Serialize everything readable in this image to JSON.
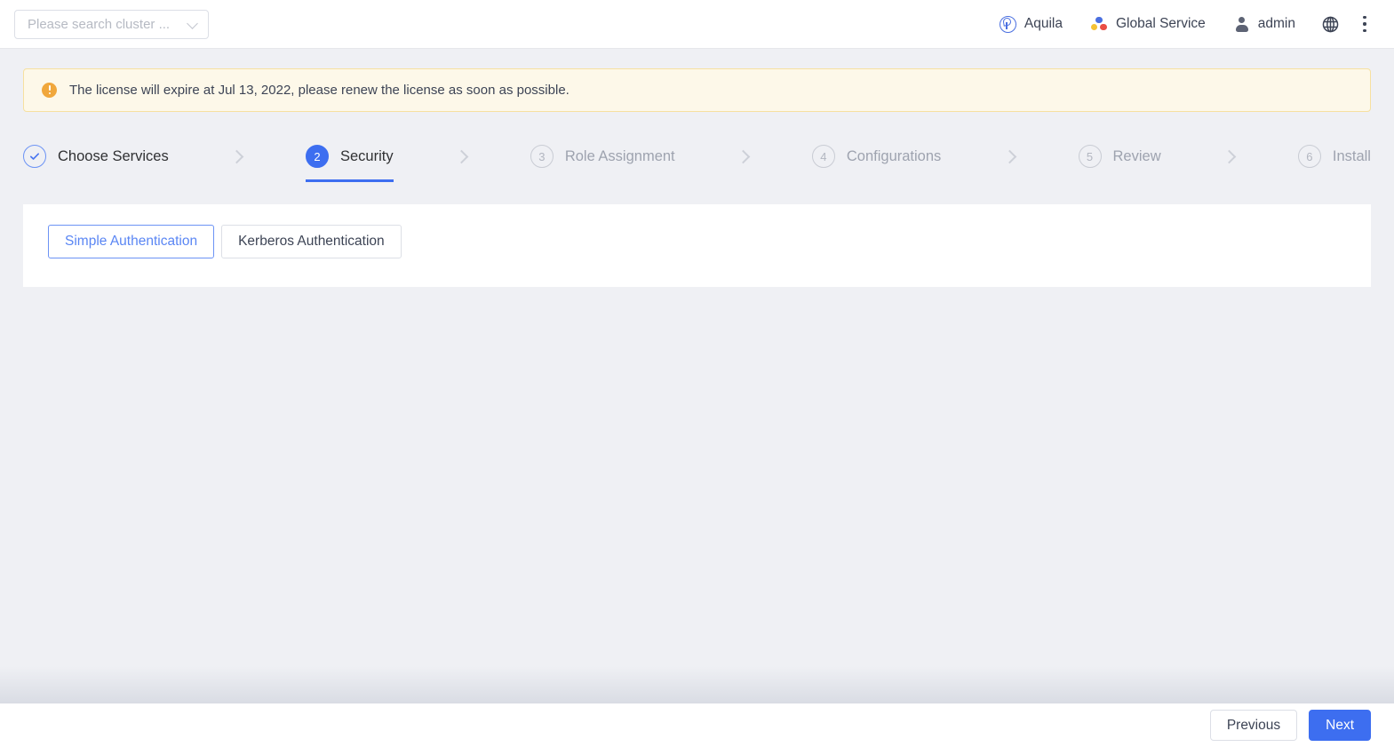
{
  "header": {
    "cluster_search": {
      "placeholder": "Please search cluster ...",
      "value": "",
      "caret_icon": "chevron-down-icon"
    },
    "items": [
      {
        "label": "Aquila",
        "icon": "aquila-logo-icon"
      },
      {
        "label": "Global Service",
        "icon": "global-service-icon"
      },
      {
        "label": "admin",
        "icon": "user-icon"
      }
    ],
    "language_icon": "globe-icon",
    "more_icon": "kebab-menu-icon"
  },
  "license_banner": {
    "icon": "warning-icon",
    "message": "The license will expire at Jul 13, 2022, please renew the license as soon as possible.",
    "expiry_date": "Jul 13, 2022",
    "bg_color": "#fdf8e9",
    "border_color": "#f6e0a0",
    "icon_color": "#f0a73c"
  },
  "stepper": {
    "active_step": 2,
    "accent_color": "#3d6ef0",
    "steps": [
      {
        "number": "1",
        "label": "Choose Services",
        "state": "done",
        "icon": "check-icon"
      },
      {
        "number": "2",
        "label": "Security",
        "state": "active"
      },
      {
        "number": "3",
        "label": "Role Assignment",
        "state": "pending"
      },
      {
        "number": "4",
        "label": "Configurations",
        "state": "pending"
      },
      {
        "number": "5",
        "label": "Review",
        "state": "pending"
      },
      {
        "number": "6",
        "label": "Install",
        "state": "pending"
      }
    ],
    "separator_icon": "chevron-right-icon"
  },
  "content": {
    "tabs": [
      {
        "label": "Simple Authentication",
        "selected": true
      },
      {
        "label": "Kerberos Authentication",
        "selected": false
      }
    ]
  },
  "footer": {
    "previous_label": "Previous",
    "next_label": "Next",
    "primary_color": "#3d6ef0"
  }
}
